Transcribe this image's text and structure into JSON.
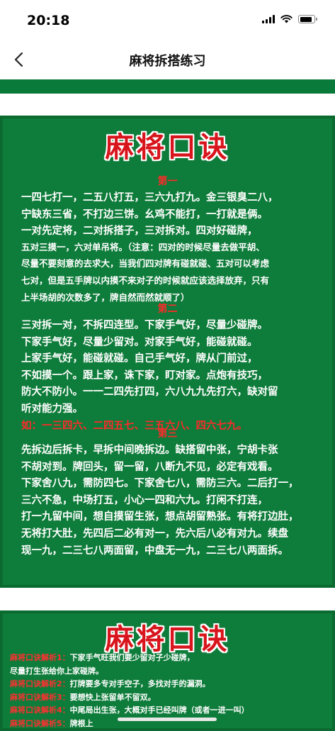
{
  "status_bar": {
    "time": "20:18",
    "battery_level": 0.92
  },
  "nav": {
    "title": "麻将拆搭练习"
  },
  "card1": {
    "title": "麻将口诀",
    "sections": [
      {
        "head": "第一",
        "lines": [
          {
            "text": "一四七打一，二五八打五，三六九打九。金三银臭二八，",
            "style": "lg"
          },
          {
            "text": "宁缺东三省，不打边三饼。幺鸡不能打，一打就是俩。",
            "style": "lg"
          },
          {
            "text": "一对先定将，二对拆搭子，三对拆对。四对好碰牌，",
            "style": "lg"
          },
          {
            "text": "五对三摸一，六对单吊将。（注意：四对的时候尽量去做平胡、",
            "style": "sm"
          },
          {
            "text": "尽量不要刻意的去求大，当我们四对牌有碰就碰、五对可以考虑",
            "style": "sm"
          },
          {
            "text": "七对，但是五手牌以内摸不来对子的时候就应该选择放弃，只有",
            "style": "sm"
          },
          {
            "text": "上半场胡的次数多了，牌自然而然就顺了）",
            "style": "sm"
          }
        ]
      },
      {
        "head": "第二",
        "lines": [
          {
            "text": "三对拆一对，不拆四连型。下家手气好，尽量少碰牌。",
            "style": "lg"
          },
          {
            "text": "下家手气好，尽量少留对。对家手气好，能碰就碰。",
            "style": "lg"
          },
          {
            "text": "上家手气好，能碰就碰。自己手气好，牌从门前过，",
            "style": "lg"
          },
          {
            "text": "不如摸一个。跟上家，诛下家，盯对家。点炮有技巧，",
            "style": "lg"
          },
          {
            "text": "防大不防小。一一二四先打四，六八九九先打六，缺对留",
            "style": "lg"
          },
          {
            "text": "听对能力强。",
            "style": "lg"
          },
          {
            "text": "如：一三四六、二四五七、三五六八、四六七九。",
            "style": "red"
          }
        ]
      },
      {
        "head": "第三",
        "lines": [
          {
            "text": "先拆边后拆卡，早拆中间晚拆边。缺搭留中张，宁胡卡张",
            "style": "lg"
          },
          {
            "text": "不胡对到。牌回头，留一留，八断九不见，必定有戏看。",
            "style": "lg"
          },
          {
            "text": "下家舍八九，需防四七。下家舍七八，需防三六。二后打一，",
            "style": "lg"
          },
          {
            "text": "三六不急，中场打五，小心一四和六九。打闲不打连，",
            "style": "lg"
          },
          {
            "text": "打一九留中间，想自摸留生张，想点胡留熟张。有将打边肚，",
            "style": "lg"
          },
          {
            "text": "无将打大肚，先四后二必有对一，先六后八必有对九。续盘",
            "style": "lg"
          },
          {
            "text": "现一九，二三七八两面留，中盘无一九，二三七八两面拆。",
            "style": "lg"
          }
        ]
      }
    ]
  },
  "card2": {
    "title": "麻将口诀",
    "analysis": [
      {
        "label": "麻将口诀解析1：",
        "text": "下家手气旺我们要少留对子少碰牌，"
      },
      {
        "label": "",
        "text": "尽量打生张给你上家碰牌。"
      },
      {
        "label": "麻将口诀解析2：",
        "text": "打牌要多专对手空子，多找对手的漏洞。"
      },
      {
        "label": "麻将口诀解析3：",
        "text": "要想快上张留单不留双。"
      },
      {
        "label": "麻将口诀解析4：",
        "text": "中尾局出生张，大概对手已经叫牌（或者一进一叫）"
      },
      {
        "label": "麻将口诀解析5：",
        "text": "牌根上"
      }
    ]
  }
}
